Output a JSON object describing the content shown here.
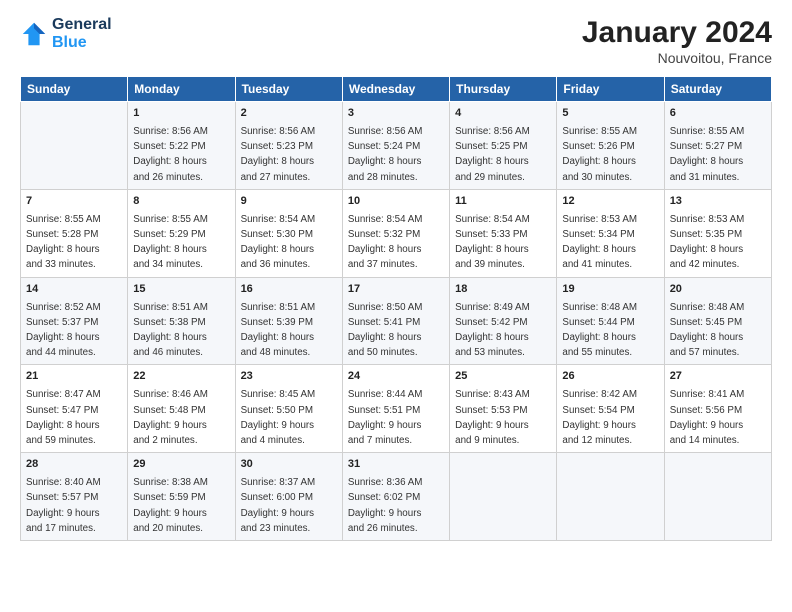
{
  "header": {
    "logo_line1": "General",
    "logo_line2": "Blue",
    "title": "January 2024",
    "subtitle": "Nouvoitou, France"
  },
  "columns": [
    "Sunday",
    "Monday",
    "Tuesday",
    "Wednesday",
    "Thursday",
    "Friday",
    "Saturday"
  ],
  "weeks": [
    [
      {
        "day": "",
        "info": ""
      },
      {
        "day": "1",
        "info": "Sunrise: 8:56 AM\nSunset: 5:22 PM\nDaylight: 8 hours\nand 26 minutes."
      },
      {
        "day": "2",
        "info": "Sunrise: 8:56 AM\nSunset: 5:23 PM\nDaylight: 8 hours\nand 27 minutes."
      },
      {
        "day": "3",
        "info": "Sunrise: 8:56 AM\nSunset: 5:24 PM\nDaylight: 8 hours\nand 28 minutes."
      },
      {
        "day": "4",
        "info": "Sunrise: 8:56 AM\nSunset: 5:25 PM\nDaylight: 8 hours\nand 29 minutes."
      },
      {
        "day": "5",
        "info": "Sunrise: 8:55 AM\nSunset: 5:26 PM\nDaylight: 8 hours\nand 30 minutes."
      },
      {
        "day": "6",
        "info": "Sunrise: 8:55 AM\nSunset: 5:27 PM\nDaylight: 8 hours\nand 31 minutes."
      }
    ],
    [
      {
        "day": "7",
        "info": "Sunrise: 8:55 AM\nSunset: 5:28 PM\nDaylight: 8 hours\nand 33 minutes."
      },
      {
        "day": "8",
        "info": "Sunrise: 8:55 AM\nSunset: 5:29 PM\nDaylight: 8 hours\nand 34 minutes."
      },
      {
        "day": "9",
        "info": "Sunrise: 8:54 AM\nSunset: 5:30 PM\nDaylight: 8 hours\nand 36 minutes."
      },
      {
        "day": "10",
        "info": "Sunrise: 8:54 AM\nSunset: 5:32 PM\nDaylight: 8 hours\nand 37 minutes."
      },
      {
        "day": "11",
        "info": "Sunrise: 8:54 AM\nSunset: 5:33 PM\nDaylight: 8 hours\nand 39 minutes."
      },
      {
        "day": "12",
        "info": "Sunrise: 8:53 AM\nSunset: 5:34 PM\nDaylight: 8 hours\nand 41 minutes."
      },
      {
        "day": "13",
        "info": "Sunrise: 8:53 AM\nSunset: 5:35 PM\nDaylight: 8 hours\nand 42 minutes."
      }
    ],
    [
      {
        "day": "14",
        "info": "Sunrise: 8:52 AM\nSunset: 5:37 PM\nDaylight: 8 hours\nand 44 minutes."
      },
      {
        "day": "15",
        "info": "Sunrise: 8:51 AM\nSunset: 5:38 PM\nDaylight: 8 hours\nand 46 minutes."
      },
      {
        "day": "16",
        "info": "Sunrise: 8:51 AM\nSunset: 5:39 PM\nDaylight: 8 hours\nand 48 minutes."
      },
      {
        "day": "17",
        "info": "Sunrise: 8:50 AM\nSunset: 5:41 PM\nDaylight: 8 hours\nand 50 minutes."
      },
      {
        "day": "18",
        "info": "Sunrise: 8:49 AM\nSunset: 5:42 PM\nDaylight: 8 hours\nand 53 minutes."
      },
      {
        "day": "19",
        "info": "Sunrise: 8:48 AM\nSunset: 5:44 PM\nDaylight: 8 hours\nand 55 minutes."
      },
      {
        "day": "20",
        "info": "Sunrise: 8:48 AM\nSunset: 5:45 PM\nDaylight: 8 hours\nand 57 minutes."
      }
    ],
    [
      {
        "day": "21",
        "info": "Sunrise: 8:47 AM\nSunset: 5:47 PM\nDaylight: 8 hours\nand 59 minutes."
      },
      {
        "day": "22",
        "info": "Sunrise: 8:46 AM\nSunset: 5:48 PM\nDaylight: 9 hours\nand 2 minutes."
      },
      {
        "day": "23",
        "info": "Sunrise: 8:45 AM\nSunset: 5:50 PM\nDaylight: 9 hours\nand 4 minutes."
      },
      {
        "day": "24",
        "info": "Sunrise: 8:44 AM\nSunset: 5:51 PM\nDaylight: 9 hours\nand 7 minutes."
      },
      {
        "day": "25",
        "info": "Sunrise: 8:43 AM\nSunset: 5:53 PM\nDaylight: 9 hours\nand 9 minutes."
      },
      {
        "day": "26",
        "info": "Sunrise: 8:42 AM\nSunset: 5:54 PM\nDaylight: 9 hours\nand 12 minutes."
      },
      {
        "day": "27",
        "info": "Sunrise: 8:41 AM\nSunset: 5:56 PM\nDaylight: 9 hours\nand 14 minutes."
      }
    ],
    [
      {
        "day": "28",
        "info": "Sunrise: 8:40 AM\nSunset: 5:57 PM\nDaylight: 9 hours\nand 17 minutes."
      },
      {
        "day": "29",
        "info": "Sunrise: 8:38 AM\nSunset: 5:59 PM\nDaylight: 9 hours\nand 20 minutes."
      },
      {
        "day": "30",
        "info": "Sunrise: 8:37 AM\nSunset: 6:00 PM\nDaylight: 9 hours\nand 23 minutes."
      },
      {
        "day": "31",
        "info": "Sunrise: 8:36 AM\nSunset: 6:02 PM\nDaylight: 9 hours\nand 26 minutes."
      },
      {
        "day": "",
        "info": ""
      },
      {
        "day": "",
        "info": ""
      },
      {
        "day": "",
        "info": ""
      }
    ]
  ]
}
